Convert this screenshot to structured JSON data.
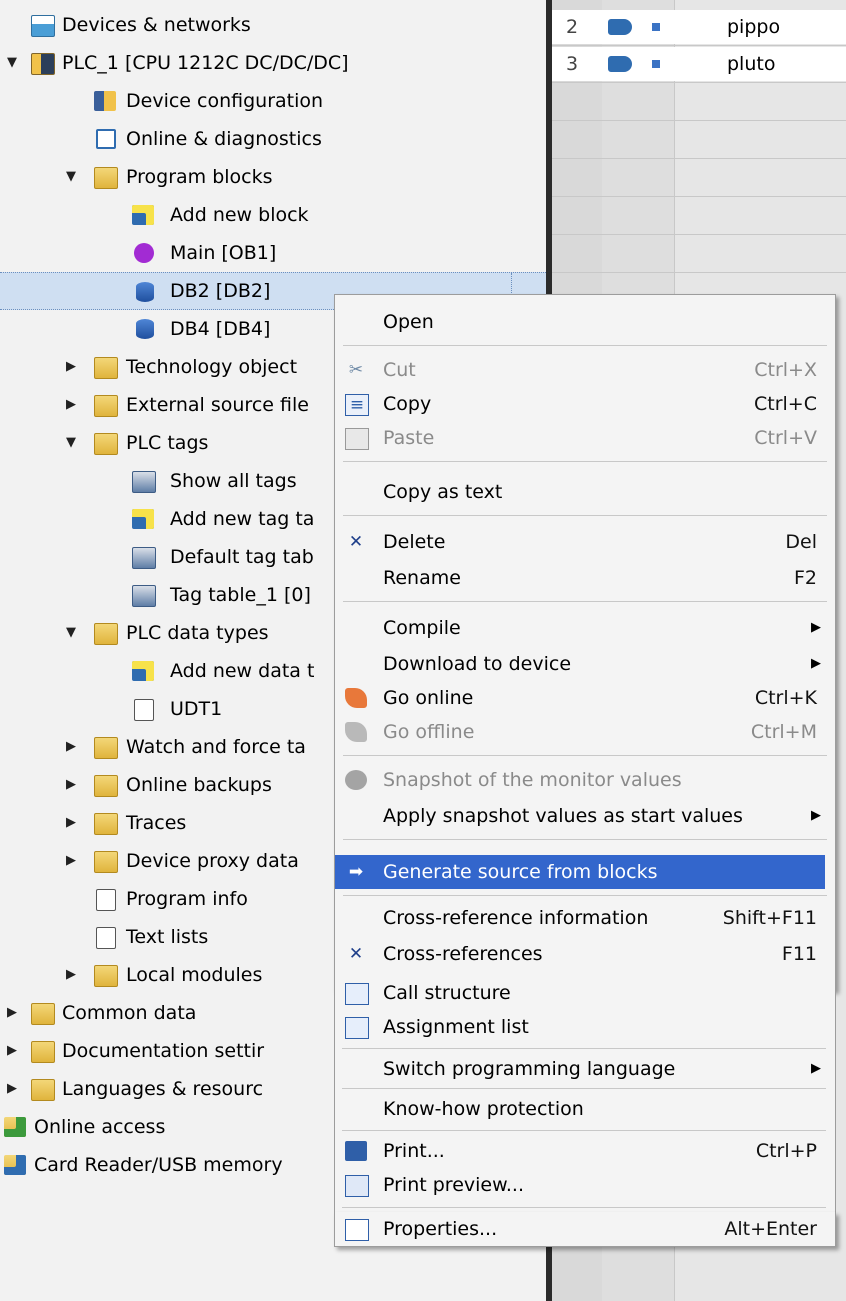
{
  "project_tree": {
    "rows": [
      {
        "label": "Devices & networks",
        "arrow": "",
        "icon": "network-icon"
      },
      {
        "label": "PLC_1 [CPU 1212C DC/DC/DC]",
        "arrow": "▼",
        "icon": "plc-icon"
      },
      {
        "label": "Device configuration",
        "arrow": "",
        "icon": "device-config-icon"
      },
      {
        "label": "Online & diagnostics",
        "arrow": "",
        "icon": "diagnostics-icon"
      },
      {
        "label": "Program blocks",
        "arrow": "▼",
        "icon": "folder-icon"
      },
      {
        "label": "Add new block",
        "arrow": "",
        "icon": "add-new-icon"
      },
      {
        "label": "Main [OB1]",
        "arrow": "",
        "icon": "ob-block-icon"
      },
      {
        "label": "DB2 [DB2]",
        "arrow": "",
        "icon": "data-block-icon"
      },
      {
        "label": "DB4 [DB4]",
        "arrow": "",
        "icon": "data-block-icon"
      },
      {
        "label": "Technology object",
        "arrow": "▶",
        "icon": "folder-icon"
      },
      {
        "label": "External source file",
        "arrow": "▶",
        "icon": "folder-icon"
      },
      {
        "label": "PLC tags",
        "arrow": "▼",
        "icon": "folder-icon"
      },
      {
        "label": "Show all tags",
        "arrow": "",
        "icon": "tags-icon"
      },
      {
        "label": "Add new tag ta",
        "arrow": "",
        "icon": "add-new-icon"
      },
      {
        "label": "Default tag tab",
        "arrow": "",
        "icon": "tags-icon"
      },
      {
        "label": "Tag table_1 [0]",
        "arrow": "",
        "icon": "tags-icon"
      },
      {
        "label": "PLC data types",
        "arrow": "▼",
        "icon": "folder-icon"
      },
      {
        "label": "Add new data t",
        "arrow": "",
        "icon": "add-new-icon"
      },
      {
        "label": "UDT1",
        "arrow": "",
        "icon": "udt-icon"
      },
      {
        "label": "Watch and force ta",
        "arrow": "▶",
        "icon": "folder-icon"
      },
      {
        "label": "Online backups",
        "arrow": "▶",
        "icon": "folder-icon"
      },
      {
        "label": "Traces",
        "arrow": "▶",
        "icon": "folder-icon"
      },
      {
        "label": "Device proxy data",
        "arrow": "▶",
        "icon": "folder-icon"
      },
      {
        "label": "Program info",
        "arrow": "",
        "icon": "program-info-icon"
      },
      {
        "label": "Text lists",
        "arrow": "",
        "icon": "text-list-icon"
      },
      {
        "label": "Local modules",
        "arrow": "▶",
        "icon": "folder-icon"
      },
      {
        "label": "Common data",
        "arrow": "▶",
        "icon": "folder-icon"
      },
      {
        "label": "Documentation settir",
        "arrow": "▶",
        "icon": "folder-icon"
      },
      {
        "label": "Languages & resourc",
        "arrow": "▶",
        "icon": "folder-icon"
      },
      {
        "label": "Online access",
        "arrow": "",
        "icon": "online-access-icon"
      },
      {
        "label": "Card Reader/USB memory",
        "arrow": "",
        "icon": "card-reader-icon"
      }
    ]
  },
  "tag_table": {
    "rows": [
      {
        "num": "2",
        "name": "pippo"
      },
      {
        "num": "3",
        "name": "pluto"
      }
    ]
  },
  "context_menu": {
    "items": [
      {
        "label": "Open",
        "shortcut": "",
        "icon": "",
        "disabled": false
      },
      {
        "label": "Cut",
        "shortcut": "Ctrl+X",
        "icon": "cut-icon",
        "disabled": true
      },
      {
        "label": "Copy",
        "shortcut": "Ctrl+C",
        "icon": "copy-icon",
        "disabled": false
      },
      {
        "label": "Paste",
        "shortcut": "Ctrl+V",
        "icon": "paste-icon",
        "disabled": true
      },
      {
        "label": "Copy as text",
        "shortcut": "",
        "icon": "",
        "disabled": false
      },
      {
        "label": "Delete",
        "shortcut": "Del",
        "icon": "delete-icon",
        "disabled": false
      },
      {
        "label": "Rename",
        "shortcut": "F2",
        "icon": "",
        "disabled": false
      },
      {
        "label": "Compile",
        "shortcut": "",
        "icon": "",
        "disabled": false,
        "submenu": true
      },
      {
        "label": "Download to device",
        "shortcut": "",
        "icon": "",
        "disabled": false,
        "submenu": true
      },
      {
        "label": "Go online",
        "shortcut": "Ctrl+K",
        "icon": "go-online-icon",
        "disabled": false
      },
      {
        "label": "Go offline",
        "shortcut": "Ctrl+M",
        "icon": "go-offline-icon",
        "disabled": true
      },
      {
        "label": "Snapshot of the monitor values",
        "shortcut": "",
        "icon": "snapshot-icon",
        "disabled": true
      },
      {
        "label": "Apply snapshot values as start values",
        "shortcut": "",
        "icon": "",
        "disabled": false,
        "submenu": true
      },
      {
        "label": "Generate source from blocks",
        "shortcut": "",
        "icon": "generate-source-icon",
        "disabled": false,
        "highlighted": true
      },
      {
        "label": "Cross-reference information",
        "shortcut": "Shift+F11",
        "icon": "",
        "disabled": false
      },
      {
        "label": "Cross-references",
        "shortcut": "F11",
        "icon": "cross-references-icon",
        "disabled": false
      },
      {
        "label": "Call structure",
        "shortcut": "",
        "icon": "call-structure-icon",
        "disabled": false
      },
      {
        "label": "Assignment list",
        "shortcut": "",
        "icon": "assignment-list-icon",
        "disabled": false
      },
      {
        "label": "Switch programming language",
        "shortcut": "",
        "icon": "",
        "disabled": false,
        "submenu": true
      },
      {
        "label": "Know-how protection",
        "shortcut": "",
        "icon": "",
        "disabled": false
      },
      {
        "label": "Print...",
        "shortcut": "Ctrl+P",
        "icon": "print-icon",
        "disabled": false
      },
      {
        "label": "Print preview...",
        "shortcut": "",
        "icon": "print-preview-icon",
        "disabled": false
      },
      {
        "label": "Properties...",
        "shortcut": "Alt+Enter",
        "icon": "properties-icon",
        "disabled": false
      }
    ],
    "submenu_arrow": "▶",
    "colors": {
      "highlight": "#3366cc",
      "disabled_text": "#8a8a8a"
    }
  }
}
